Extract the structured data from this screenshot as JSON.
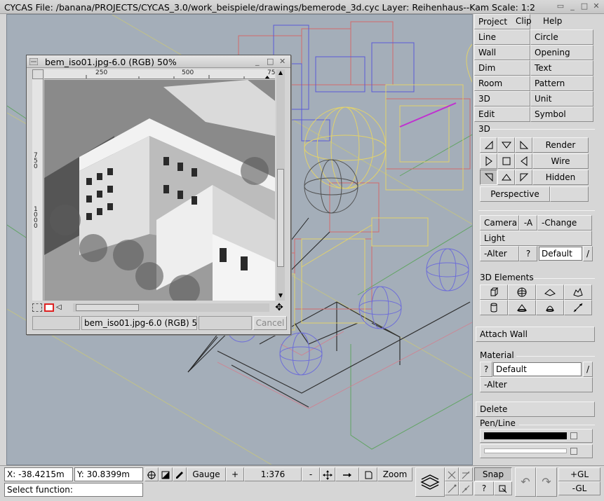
{
  "window": {
    "title": "CYCAS  File: /banana/PROJECTS/CYCAS_3.0/work_beispiele/drawings/bemerode_3d.cyc  Layer: Reihenhaus--Kam  Scale: 1:2",
    "btn_menu": "▭",
    "btn_min": "_",
    "btn_max": "□",
    "btn_close": "✕"
  },
  "menu": {
    "project": "Project",
    "clip": "Clip",
    "help": "Help",
    "line": "Line",
    "circle": "Circle",
    "wall": "Wall",
    "opening": "Opening",
    "dim": "Dim",
    "text": "Text",
    "room": "Room",
    "pattern": "Pattern",
    "d3": "3D",
    "unit": "Unit",
    "edit": "Edit",
    "symbol": "Symbol"
  },
  "panel3d": {
    "label": "3D",
    "render": "Render",
    "wire": "Wire",
    "hidden": "Hidden",
    "perspective": "Perspective",
    "camera": "Camera",
    "minus_a": "-A",
    "change": "-Change",
    "light": "Light",
    "alter": "-Alter",
    "question": "?",
    "light_value": "Default",
    "slash": "/"
  },
  "elements3d": {
    "label": "3D Elements"
  },
  "attach_wall": "Attach Wall",
  "material": {
    "label": "Material",
    "question": "?",
    "value": "Default",
    "slash": "/",
    "alter": "-Alter"
  },
  "delete": "Delete",
  "penline": {
    "label": "Pen/Line"
  },
  "status": {
    "x": "X: -38.4215m",
    "y": "Y: 30.8399m",
    "gauge": "Gauge",
    "plus": "+",
    "scale": "1:376",
    "minus": "-",
    "zoom": "Zoom",
    "snap": "Snap",
    "gl_plus": "+GL",
    "gl_minus": "-GL",
    "question": "?",
    "prompt": "Select function:"
  },
  "image_window": {
    "title": "bem_iso01.jpg-6.0 (RGB) 50%",
    "ruler_h": [
      "250",
      "500",
      "75"
    ],
    "ruler_v": [
      "750",
      "1000"
    ],
    "status_text": "bem_iso01.jpg-6.0 (RGB) 50",
    "cancel": "Cancel"
  },
  "colors": {
    "canvas": "#a4aeb9",
    "panel": "#d6d6d6",
    "wire_red": "#d26a6a",
    "wire_blue": "#5a5ad6",
    "wire_yellow": "#e2d26a"
  }
}
